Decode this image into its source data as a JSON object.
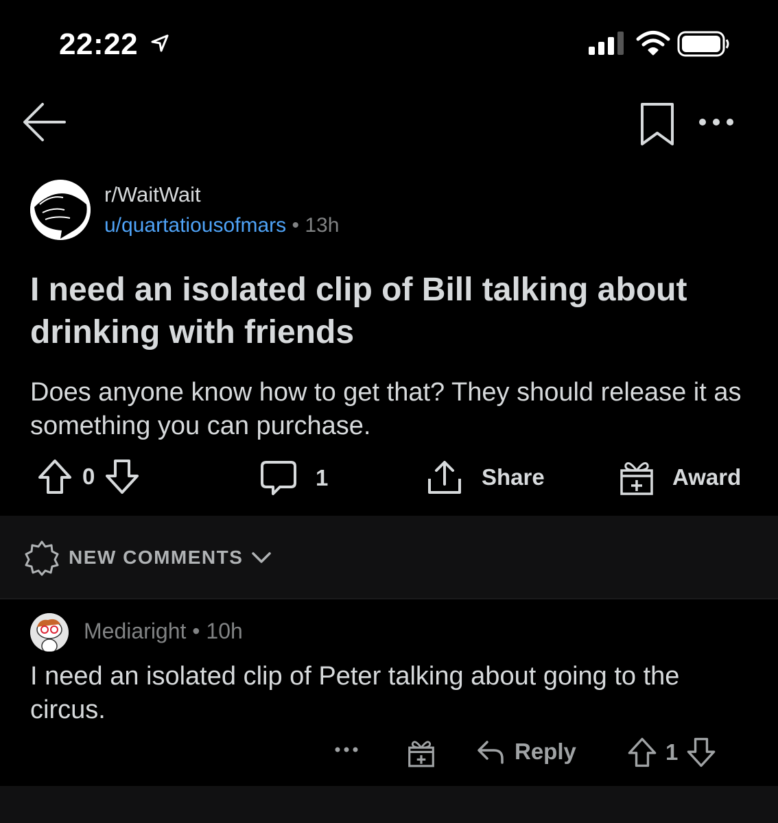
{
  "status_bar": {
    "time": "22:22",
    "icons": [
      "location-arrow-icon",
      "cellular-signal-icon",
      "wifi-icon",
      "battery-icon"
    ]
  },
  "nav": {
    "icons": [
      "back-arrow-icon",
      "bookmark-icon",
      "more-icon"
    ]
  },
  "post": {
    "subreddit": "r/WaitWait",
    "author": "u/quartatiousofmars",
    "separator": "•",
    "age": "13h",
    "title": "I need an isolated clip of Bill talking about drinking with friends",
    "body": "Does anyone know how to get that? They should release it as something you can purchase.",
    "actions": {
      "score": "0",
      "comments_count": "1",
      "share_label": "Share",
      "award_label": "Award"
    }
  },
  "comments_section": {
    "sort_label": "NEW COMMENTS"
  },
  "comment": {
    "author": "Mediaright",
    "separator": "•",
    "age": "10h",
    "body": "I need an isolated clip of Peter talking about going to the circus.",
    "actions": {
      "reply_label": "Reply",
      "score": "1"
    }
  },
  "colors": {
    "background": "#000000",
    "text": "#d7dadc",
    "muted": "#818384",
    "link": "#4fa3f7",
    "band": "#111112"
  }
}
